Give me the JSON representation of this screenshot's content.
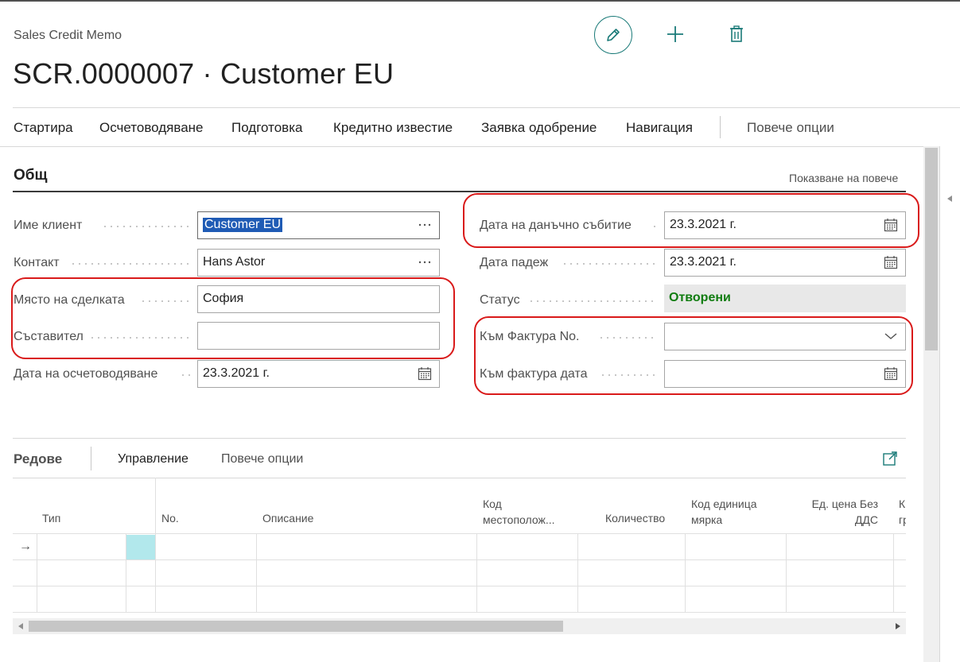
{
  "header": {
    "page_type": "Sales Credit Memo",
    "title": "SCR.0000007 · Customer EU"
  },
  "actions": {
    "edit_icon": "pencil-icon",
    "new_icon": "plus-icon",
    "delete_icon": "trash-icon"
  },
  "menu": {
    "items": [
      "Стартира",
      "Осчетоводяване",
      "Подготовка",
      "Кредитно известие",
      "Заявка одобрение",
      "Навигация"
    ],
    "more": "Повече опции"
  },
  "general": {
    "title": "Общ",
    "show_more": "Показване на повече",
    "left_fields": [
      {
        "label": "Име клиент",
        "value": "Customer EU",
        "trailing": "ellipsis"
      },
      {
        "label": "Контакт",
        "value": "Hans Astor",
        "trailing": "ellipsis"
      },
      {
        "label": "Място на сделката",
        "value": "София",
        "trailing": ""
      },
      {
        "label": "Съставител",
        "value": "",
        "trailing": ""
      },
      {
        "label": "Дата на осчетоводяване",
        "value": "23.3.2021 г.",
        "trailing": "calendar"
      }
    ],
    "right_fields": [
      {
        "label": "Дата на данъчно събитие",
        "value": "23.3.2021 г.",
        "trailing": "calendar"
      },
      {
        "label": "Дата падеж",
        "value": "23.3.2021 г.",
        "trailing": "calendar"
      },
      {
        "label": "Статус",
        "value": "Отворени",
        "trailing": ""
      },
      {
        "label": "Към Фактура No.",
        "value": "",
        "trailing": "chevron"
      },
      {
        "label": "Към фактура дата",
        "value": "",
        "trailing": "calendar"
      }
    ]
  },
  "lines": {
    "title": "Редове",
    "manage": "Управление",
    "more": "Повече опции",
    "columns": [
      {
        "line1": "Тип",
        "line2": ""
      },
      {
        "line1": "No.",
        "line2": ""
      },
      {
        "line1": "Описание",
        "line2": ""
      },
      {
        "line1": "Код",
        "line2": "местополож..."
      },
      {
        "line1": "Количество",
        "line2": ""
      },
      {
        "line1": "Код единица",
        "line2": "мярка"
      },
      {
        "line1": "Ед. цена Без",
        "line2": "ДДС"
      },
      {
        "line1": "К",
        "line2": "гр"
      }
    ],
    "row_indicator": "→"
  },
  "colors": {
    "accent": "#1a7a78",
    "status_open": "#107c10",
    "highlight": "#d91a1a",
    "selection": "#1f5bb5",
    "active_cell": "#b2e8ec"
  }
}
